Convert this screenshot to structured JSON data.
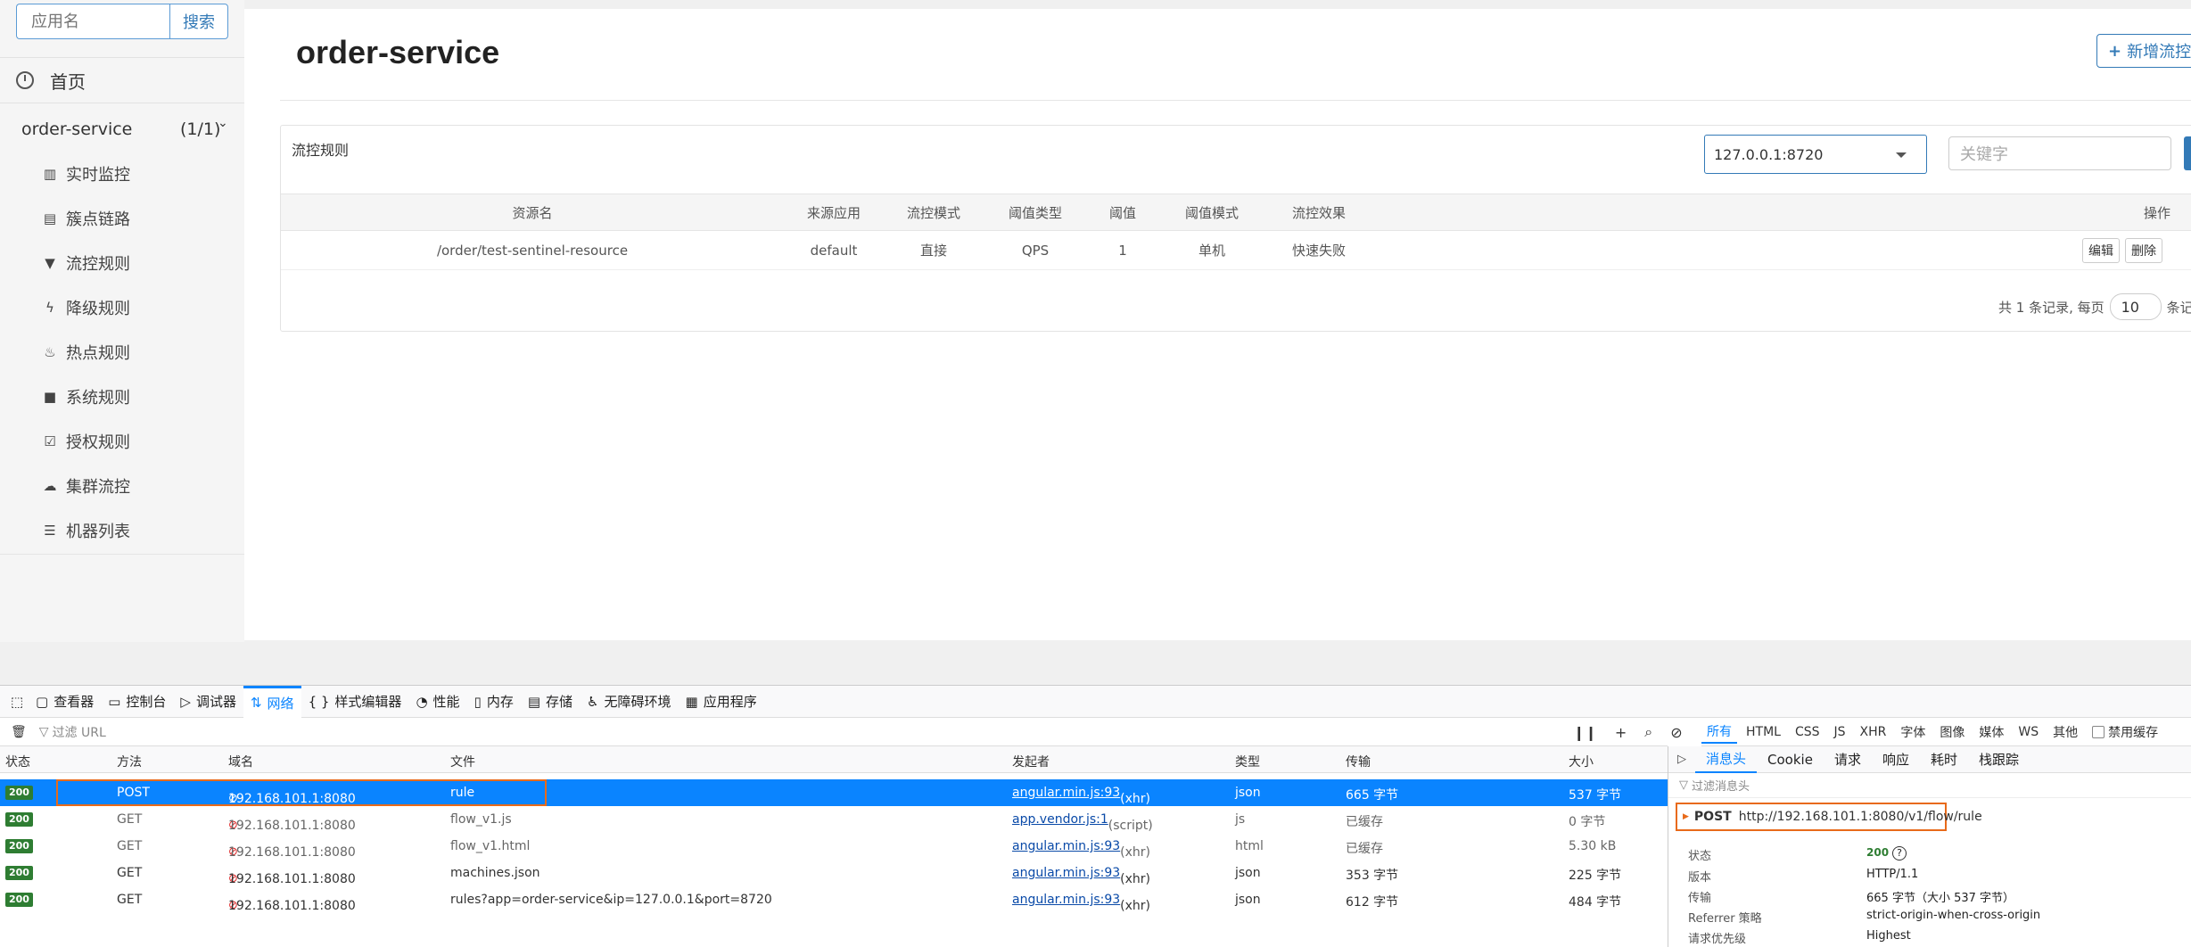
{
  "sidebar": {
    "search_placeholder": "应用名",
    "search_button": "搜索",
    "home": "首页",
    "app": {
      "name": "order-service",
      "count": "(1/1)"
    },
    "menu": [
      {
        "label": "实时监控",
        "icon": "bar-chart-icon"
      },
      {
        "label": "簇点链路",
        "icon": "list-icon"
      },
      {
        "label": "流控规则",
        "icon": "filter-icon"
      },
      {
        "label": "降级规则",
        "icon": "bolt-icon"
      },
      {
        "label": "热点规则",
        "icon": "fire-icon"
      },
      {
        "label": "系统规则",
        "icon": "lock-icon"
      },
      {
        "label": "授权规则",
        "icon": "check-square-icon"
      },
      {
        "label": "集群流控",
        "icon": "cloud-icon"
      },
      {
        "label": "机器列表",
        "icon": "th-list-icon"
      }
    ]
  },
  "main": {
    "title": "order-service",
    "add_button": "新增流控",
    "panel_title": "流控规则",
    "machine_select": "127.0.0.1:8720",
    "keyword_placeholder": "关键字",
    "columns": [
      "资源名",
      "来源应用",
      "流控模式",
      "阈值类型",
      "阈值",
      "阈值模式",
      "流控效果",
      "操作"
    ],
    "rows": [
      {
        "resource": "/order/test-sentinel-resource",
        "limitApp": "default",
        "mode": "直接",
        "grade": "QPS",
        "count": "1",
        "cluster": "单机",
        "effect": "快速失败",
        "edit": "编辑",
        "delete": "删除"
      }
    ],
    "pager": {
      "prefix": "共 1 条记录, 每页",
      "page_size": "10",
      "suffix": "条记"
    }
  },
  "devtools": {
    "tabs": [
      "查看器",
      "控制台",
      "调试器",
      "网络",
      "样式编辑器",
      "性能",
      "内存",
      "存储",
      "无障碍环境",
      "应用程序"
    ],
    "active_tab": "网络",
    "filter_placeholder": "过滤 URL",
    "type_filters": [
      "所有",
      "HTML",
      "CSS",
      "JS",
      "XHR",
      "字体",
      "图像",
      "媒体",
      "WS",
      "其他"
    ],
    "disable_cache": "禁用缓存",
    "columns": [
      "状态",
      "方法",
      "域名",
      "文件",
      "发起者",
      "类型",
      "传输",
      "大小"
    ],
    "requests": [
      {
        "status": "200",
        "method": "POST",
        "domain": "192.168.101.1:8080",
        "file": "rule",
        "initiator": "angular.min.js:93",
        "initiator_type": "(xhr)",
        "type": "json",
        "transfer": "665 字节",
        "size": "537 字节"
      },
      {
        "status": "200",
        "method": "GET",
        "domain": "192.168.101.1:8080",
        "file": "flow_v1.js",
        "initiator": "app.vendor.js:1",
        "initiator_type": "(script)",
        "type": "js",
        "transfer": "已缓存",
        "size": "0 字节"
      },
      {
        "status": "200",
        "method": "GET",
        "domain": "192.168.101.1:8080",
        "file": "flow_v1.html",
        "initiator": "angular.min.js:93",
        "initiator_type": "(xhr)",
        "type": "html",
        "transfer": "已缓存",
        "size": "5.30 kB"
      },
      {
        "status": "200",
        "method": "GET",
        "domain": "192.168.101.1:8080",
        "file": "machines.json",
        "initiator": "angular.min.js:93",
        "initiator_type": "(xhr)",
        "type": "json",
        "transfer": "353 字节",
        "size": "225 字节"
      },
      {
        "status": "200",
        "method": "GET",
        "domain": "192.168.101.1:8080",
        "file": "rules?app=order-service&ip=127.0.0.1&port=8720",
        "initiator": "angular.min.js:93",
        "initiator_type": "(xhr)",
        "type": "json",
        "transfer": "612 字节",
        "size": "484 字节"
      }
    ],
    "detail": {
      "tabs": [
        "消息头",
        "Cookie",
        "请求",
        "响应",
        "耗时",
        "栈跟踪"
      ],
      "filter_placeholder": "过滤消息头",
      "method": "POST",
      "url": "http://192.168.101.1:8080/v1/flow/rule",
      "fields": [
        {
          "k": "状态",
          "v": "200"
        },
        {
          "k": "版本",
          "v": "HTTP/1.1"
        },
        {
          "k": "传输",
          "v": "665 字节（大小 537 字节）"
        },
        {
          "k": "Referrer 策略",
          "v": "strict-origin-when-cross-origin"
        },
        {
          "k": "请求优先级",
          "v": "Highest"
        }
      ]
    }
  }
}
